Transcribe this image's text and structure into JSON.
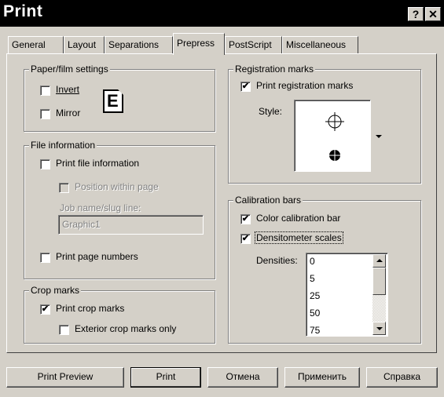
{
  "window": {
    "title": "Print",
    "help_label": "?",
    "close_label": "✕"
  },
  "tabs": [
    {
      "label": "General"
    },
    {
      "label": "Layout"
    },
    {
      "label": "Separations"
    },
    {
      "label": "Prepress",
      "active": true
    },
    {
      "label": "PostScript"
    },
    {
      "label": "Miscellaneous"
    }
  ],
  "paper_film": {
    "legend": "Paper/film settings",
    "invert_label": "Invert",
    "invert_checked": false,
    "mirror_label": "Mirror",
    "mirror_checked": false,
    "preview_glyph": "E"
  },
  "file_info": {
    "legend": "File information",
    "print_file_info_label": "Print file information",
    "print_file_info_checked": false,
    "position_label": "Position within page",
    "job_name_label": "Job name/slug line:",
    "job_name_value": "Graphic1",
    "print_page_numbers_label": "Print page numbers",
    "print_page_numbers_checked": false
  },
  "crop_marks": {
    "legend": "Crop marks",
    "print_crop_label": "Print crop marks",
    "print_crop_checked": true,
    "exterior_label": "Exterior crop marks only",
    "exterior_checked": false
  },
  "registration": {
    "legend": "Registration marks",
    "print_reg_label": "Print registration marks",
    "print_reg_checked": true,
    "style_label": "Style:"
  },
  "calibration": {
    "legend": "Calibration bars",
    "color_bar_label": "Color calibration bar",
    "color_bar_checked": true,
    "densitometer_label": "Densitometer scales",
    "densitometer_checked": true,
    "densities_label": "Densities:",
    "densities": [
      "0",
      "5",
      "25",
      "50",
      "75"
    ]
  },
  "buttons": {
    "print_preview": "Print Preview",
    "print": "Print",
    "cancel": "Отмена",
    "apply": "Применить",
    "help": "Справка"
  },
  "check_glyph": "✔"
}
